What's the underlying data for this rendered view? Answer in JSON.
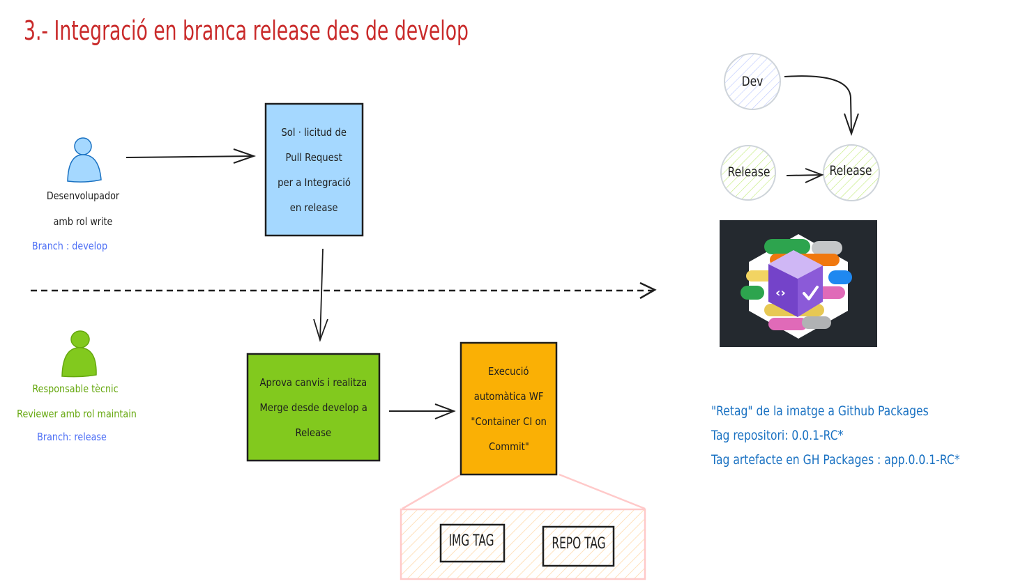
{
  "title": "3.- Integració en branca release des de develop",
  "actors": {
    "developer": {
      "line1": "Desenvolupador",
      "line2": "amb rol write",
      "branch": "Branch : develop",
      "color": "#a5d8ff",
      "stroke": "#1971c2"
    },
    "tech_lead": {
      "line1": "Responsable tècnic",
      "line2": "Reviewer amb rol maintain",
      "branch": "Branch: release",
      "color": "#82c91e",
      "stroke": "#66a80f"
    }
  },
  "boxes": {
    "pull_request": {
      "lines": [
        "Sol · licitud de",
        "Pull Request",
        "per a Integració",
        "en release"
      ],
      "color": "#a5d8ff"
    },
    "approve_merge": {
      "lines": [
        "Aprova canvis i realitza",
        "Merge desde develop a",
        "Release"
      ],
      "color": "#82c91e"
    },
    "workflow": {
      "lines": [
        "Execució",
        "automàtica WF",
        "\"Container CI on",
        "Commit\""
      ],
      "color": "#fab005"
    }
  },
  "tags": {
    "img_tag": "IMG TAG",
    "repo_tag": "REPO TAG"
  },
  "branch_diagram": {
    "nodes": [
      {
        "id": "dev",
        "label": "Dev"
      },
      {
        "id": "release_a",
        "label": "Release"
      },
      {
        "id": "release_b",
        "label": "Release"
      }
    ]
  },
  "logo": {
    "name": "GitHub Packages logo",
    "background": "#24292f"
  },
  "notes": [
    "\"Retag\" de la imatge a Github Packages",
    "Tag repositori: 0.0.1-RC*",
    "Tag artefacte en GH Packages : app.0.0.1-RC*"
  ],
  "colors": {
    "title": "#c92a2a",
    "branch_text": "#4c6ef5",
    "tech_lead_text": "#66a80f",
    "note_text": "#1971c2"
  }
}
